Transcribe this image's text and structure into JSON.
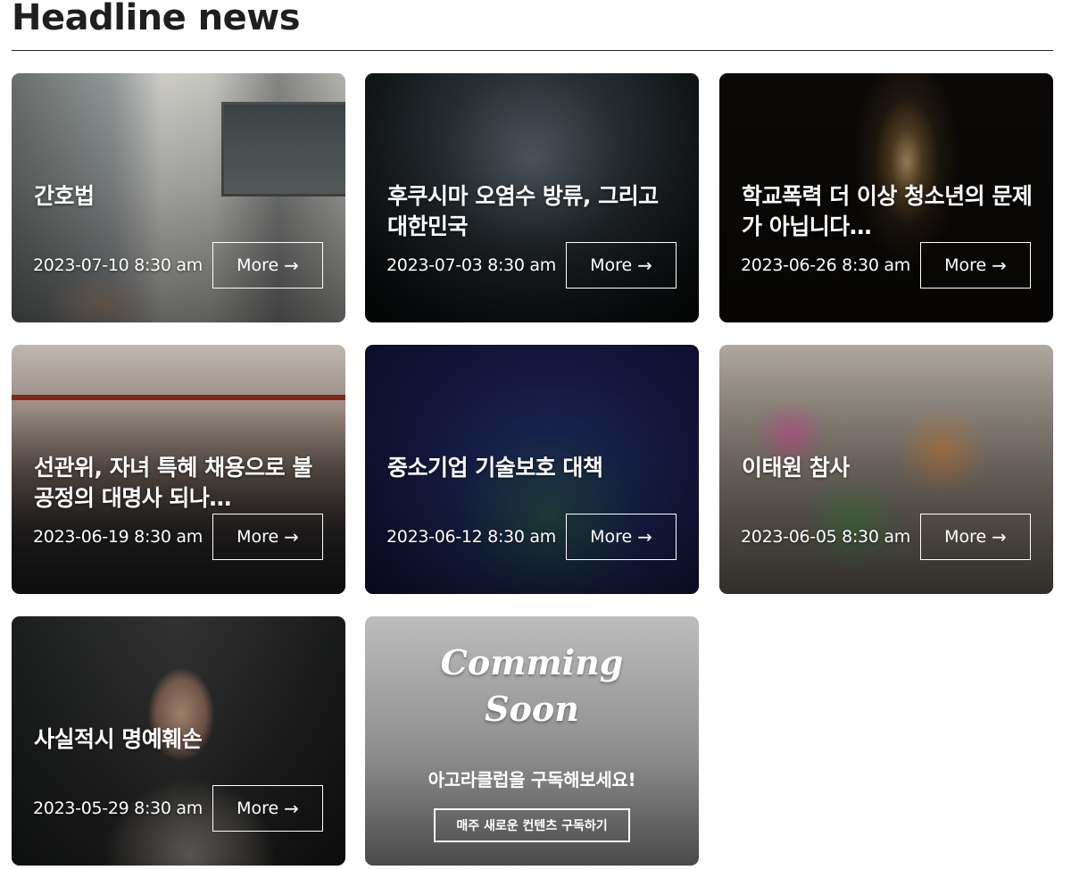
{
  "page": {
    "title": "Headline news"
  },
  "more_label": "More",
  "cards": [
    {
      "title": "간호법",
      "date": "2023-07-10 8:30 am"
    },
    {
      "title": "후쿠시마 오염수 방류, 그리고 대한민국",
      "date": "2023-07-03 8:30 am"
    },
    {
      "title": "학교폭력 더 이상 청소년의 문제가 아닙니다…",
      "date": "2023-06-26 8:30 am"
    },
    {
      "title": "선관위, 자녀 특혜 채용으로 불공정의 대명사 되나…",
      "date": "2023-06-19 8:30 am"
    },
    {
      "title": "중소기업 기술보호 대책",
      "date": "2023-06-12 8:30 am"
    },
    {
      "title": "이태원 참사",
      "date": "2023-06-05 8:30 am"
    },
    {
      "title": "사실적시 명예훼손",
      "date": "2023-05-29 8:30 am"
    }
  ],
  "coming_soon": {
    "line1": "Comming",
    "line2": "Soon",
    "subtitle": "아고라클럽을 구독해보세요!",
    "button": "매주 새로운 컨텐츠 구독하기"
  }
}
